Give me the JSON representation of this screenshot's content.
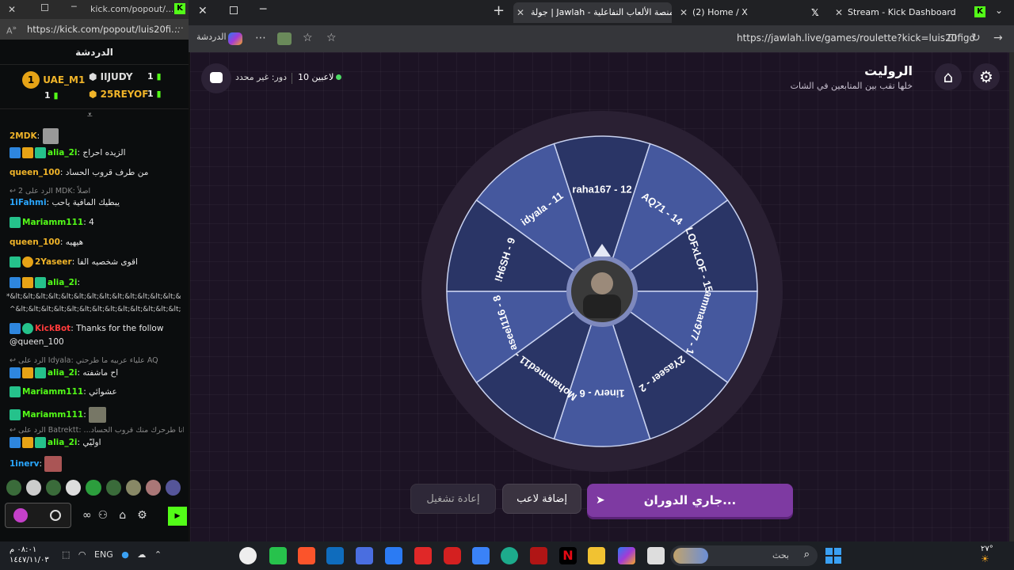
{
  "left_window": {
    "tab_title": "kick.com/popout/...",
    "url": "https://kick.com/popout/luis20fi...",
    "chat_title": "الدردشة",
    "leaders": [
      {
        "rank": "1",
        "name": "UAE_M1",
        "count": "1"
      },
      {
        "rank": "2",
        "name": "IIJUDY",
        "count": "1"
      },
      {
        "rank": "3",
        "name": "25REYOF",
        "count": "1"
      }
    ],
    "messages": [
      {
        "user": "2MDK",
        "text": ""
      },
      {
        "user": "alia_2i",
        "text": "الزيده احراج"
      },
      {
        "user": "queen_100",
        "text": "من طرف قروب الحساد"
      },
      {
        "reply": "الرد على 2 MDK: اصلاً"
      },
      {
        "user": "1iFahmi",
        "text": "يبطيك المافية ياحب"
      },
      {
        "user": "Mariamm111",
        "text": "4"
      },
      {
        "user": "queen_100",
        "text": "هيهيه"
      },
      {
        "user": "2Yaseer",
        "text": "اقوى شخصيه الفا"
      },
      {
        "user": "alia_2i",
        "text": ""
      },
      {
        "text": "*&lt;&lt;&lt;&lt;&lt;&lt;&lt;&lt;&lt;&lt;&lt;&lt;&lt;&lt;&lt;&lt;&lt;&lt;&lt;&lt;&lt;&lt;&lt;&lt;&lt;&lt;&lt;&lt;&lt;&lt;&lt;&lt;&lt;&lt;&lt;&lt;&lt;&lt;&lt;"
      },
      {
        "text": "^&lt;&lt;&lt;&lt;&lt;&lt;&lt;&lt;&lt;&lt;&lt;&lt;&lt;"
      },
      {
        "user": "KickBot",
        "text": "Thanks for the follow"
      },
      {
        "text": "@queen_100"
      },
      {
        "reply": "الرد على Idyala: علياء عربيه ما طرحتي AQ"
      },
      {
        "user": "alia_2i",
        "text": "اح ماشفته"
      },
      {
        "user": "Mariamm111",
        "text": "عشوائي"
      },
      {
        "user": "Mariamm111",
        "text": ""
      },
      {
        "reply": "الرد على Batrektt: ...ياك انا طرحرك منك قروب الحساد"
      },
      {
        "user": "alia_2i",
        "text": "اوليّي"
      },
      {
        "user": "1inerv",
        "text": ""
      }
    ]
  },
  "browser": {
    "tabs": [
      {
        "label": "جولة | Jawlah - منصة الألعاب التفاعلية"
      },
      {
        "label": "(2) Home / X"
      },
      {
        "label": "Stream - Kick Dashboard"
      }
    ],
    "sidebar_label": "الدردشة",
    "url": "https://jawlah.live/games/roulette?kick=luis20figo"
  },
  "game": {
    "title": "الروليت",
    "subtitle": "خلها تقب بين المتابعين في الشات",
    "players": "10 لاعبين",
    "turn": "دور: غير محدد",
    "segments": [
      {
        "label": "raha167 - 12",
        "color": "#2a3566"
      },
      {
        "label": "AQ71 - 14",
        "color": "#45589e"
      },
      {
        "label": "LOFxLOF - 15",
        "color": "#2a3566"
      },
      {
        "label": "ammar977 - 1",
        "color": "#45589e"
      },
      {
        "label": "2Yaseer - 2",
        "color": "#2a3566"
      },
      {
        "label": "1inerv - 6",
        "color": "#45589e"
      },
      {
        "label": "Mohammed11 - 7",
        "color": "#2a3566"
      },
      {
        "label": "aseel116 - 8",
        "color": "#45589e"
      },
      {
        "label": "!H6SH - 9",
        "color": "#2a3566"
      },
      {
        "label": "idyala - 11",
        "color": "#45589e"
      }
    ],
    "spin_label": "جاري الدوران...",
    "add_label": "إضافة لاعب",
    "restart_label": "إعادة تشغيل"
  },
  "taskbar": {
    "time": "٠٨:٠١ م",
    "date": "١٤٤٧/١١/٠٣",
    "lang": "ENG",
    "search": "بحث",
    "weather": "٢٧°"
  }
}
